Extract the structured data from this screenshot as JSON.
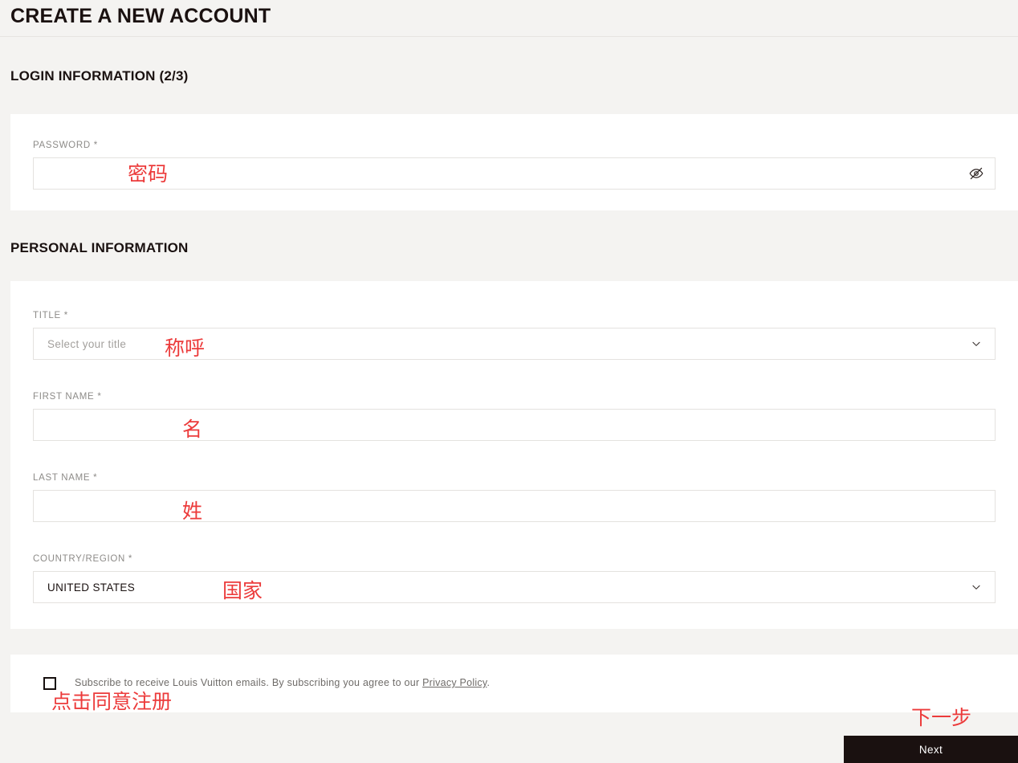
{
  "header": {
    "title": "CREATE A NEW ACCOUNT"
  },
  "sections": {
    "login_heading": "LOGIN INFORMATION (2/3)",
    "personal_heading": "PERSONAL INFORMATION"
  },
  "fields": {
    "password": {
      "label": "PASSWORD *",
      "value": "",
      "placeholder": "",
      "icon": "eye-slash-icon"
    },
    "title": {
      "label": "TITLE *",
      "placeholder": "Select your title",
      "value": "",
      "icon": "chevron-down-icon"
    },
    "first_name": {
      "label": "FIRST NAME *",
      "value": "",
      "placeholder": ""
    },
    "last_name": {
      "label": "LAST NAME *",
      "value": "",
      "placeholder": ""
    },
    "country": {
      "label": "COUNTRY/REGION *",
      "value": "UNITED STATES",
      "icon": "chevron-down-icon"
    }
  },
  "subscribe": {
    "checked": false,
    "text_before": "Subscribe to receive Louis Vuitton emails. By subscribing you agree to our ",
    "link_text": "Privacy Policy",
    "text_after": "."
  },
  "footer": {
    "next_label": "Next"
  },
  "annotations": {
    "password": "密码",
    "title": "称呼",
    "first_name": "名",
    "last_name": "姓",
    "country": "国家",
    "subscribe": "点击同意注册",
    "next": "下一步"
  },
  "colors": {
    "background": "#f4f3f1",
    "card": "#ffffff",
    "text": "#1a1110",
    "label": "#8d8b88",
    "border": "#e4e2df",
    "annotation": "#ec3b3b",
    "button": "#1a1110"
  }
}
